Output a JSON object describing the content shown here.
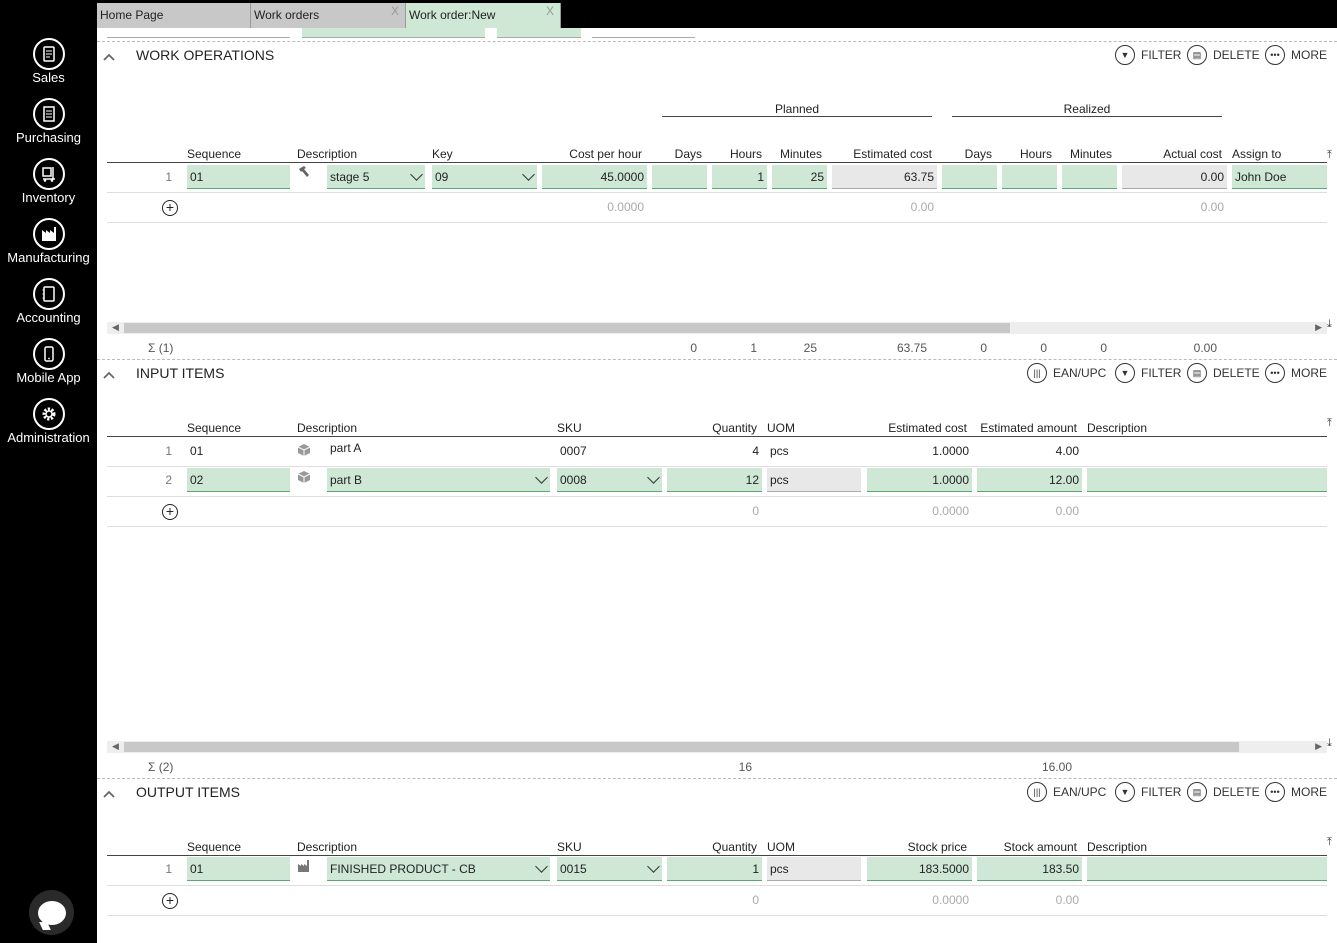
{
  "sidebar": {
    "items": [
      {
        "label": "Sales",
        "icon": "sales-icon"
      },
      {
        "label": "Purchasing",
        "icon": "purchasing-icon"
      },
      {
        "label": "Inventory",
        "icon": "inventory-icon"
      },
      {
        "label": "Manufacturing",
        "icon": "manufacturing-icon"
      },
      {
        "label": "Accounting",
        "icon": "accounting-icon"
      },
      {
        "label": "Mobile App",
        "icon": "mobile-app-icon"
      },
      {
        "label": "Administration",
        "icon": "administration-icon"
      }
    ]
  },
  "tabs": [
    {
      "label": "Home Page",
      "active": false,
      "closable": false
    },
    {
      "label": "Work orders",
      "active": false,
      "closable": true
    },
    {
      "label": "Work order:New",
      "active": true,
      "closable": true
    }
  ],
  "tab_close": "X",
  "colors": {
    "accent_green": "#cfe8d6",
    "tab_gray": "#c8c8c8",
    "sidebar": "#000000"
  },
  "actions": {
    "filter": "FILTER",
    "delete": "DELETE",
    "more": "MORE",
    "ean": "EAN/UPC"
  },
  "operations": {
    "title": "WORK OPERATIONS",
    "group_planned": "Planned",
    "group_realized": "Realized",
    "headers": {
      "sequence": "Sequence",
      "description": "Description",
      "key": "Key",
      "cost_per_hour": "Cost per hour",
      "days": "Days",
      "hours": "Hours",
      "minutes": "Minutes",
      "estimated_cost": "Estimated cost",
      "r_days": "Days",
      "r_hours": "Hours",
      "r_minutes": "Minutes",
      "actual_cost": "Actual cost",
      "assign_to": "Assign to"
    },
    "row": {
      "num": "1",
      "sequence": "01",
      "description": "stage 5",
      "key": "09",
      "cost_per_hour": "45.0000",
      "days": "",
      "hours": "1",
      "minutes": "25",
      "estimated_cost": "63.75",
      "r_days": "",
      "r_hours": "",
      "r_minutes": "",
      "actual_cost": "0.00",
      "assign_to": "John Doe"
    },
    "new_row": {
      "cost_per_hour": "0.0000",
      "estimated_cost": "0.00",
      "actual_cost": "0.00"
    },
    "totals": {
      "count": "Σ (1)",
      "days": "0",
      "hours": "1",
      "minutes": "25",
      "estimated_cost": "63.75",
      "r_days": "0",
      "r_hours": "0",
      "r_minutes": "0",
      "actual_cost": "0.00"
    }
  },
  "inputs": {
    "title": "INPUT ITEMS",
    "headers": {
      "sequence": "Sequence",
      "description": "Description",
      "sku": "SKU",
      "quantity": "Quantity",
      "uom": "UOM",
      "estimated_cost": "Estimated cost",
      "estimated_amount": "Estimated amount",
      "description2": "Description"
    },
    "rows": [
      {
        "num": "1",
        "sequence": "01",
        "description": "part A",
        "sku": "0007",
        "quantity": "4",
        "uom": "pcs",
        "estimated_cost": "1.0000",
        "estimated_amount": "4.00"
      },
      {
        "num": "2",
        "sequence": "02",
        "description": "part B",
        "sku": "0008",
        "quantity": "12",
        "uom": "pcs",
        "estimated_cost": "1.0000",
        "estimated_amount": "12.00"
      }
    ],
    "new_row": {
      "quantity": "0",
      "estimated_cost": "0.0000",
      "estimated_amount": "0.00"
    },
    "totals": {
      "count": "Σ (2)",
      "quantity": "16",
      "estimated_amount": "16.00"
    }
  },
  "outputs": {
    "title": "OUTPUT ITEMS",
    "headers": {
      "sequence": "Sequence",
      "description": "Description",
      "sku": "SKU",
      "quantity": "Quantity",
      "uom": "UOM",
      "stock_price": "Stock price",
      "stock_amount": "Stock amount",
      "description2": "Description"
    },
    "row": {
      "num": "1",
      "sequence": "01",
      "description": "FINISHED PRODUCT - CB",
      "sku": "0015",
      "quantity": "1",
      "uom": "pcs",
      "stock_price": "183.5000",
      "stock_amount": "183.50"
    },
    "new_row": {
      "quantity": "0",
      "stock_price": "0.0000",
      "stock_amount": "0.00"
    }
  }
}
